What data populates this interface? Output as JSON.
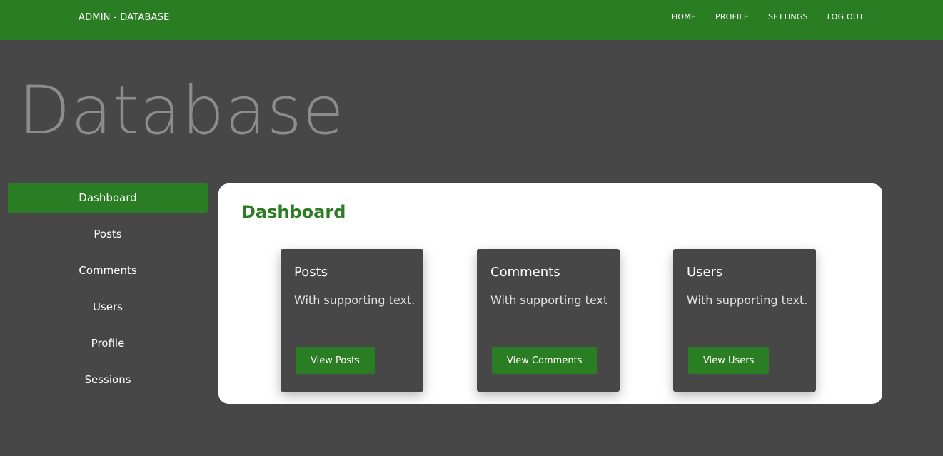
{
  "header": {
    "brand": "ADMIN - DATABASE",
    "nav": [
      "HOME",
      "PROFILE",
      "SETTINGS",
      "LOG OUT"
    ]
  },
  "hero": {
    "title": "Database"
  },
  "sidebar": {
    "items": [
      {
        "label": "Dashboard",
        "active": true
      },
      {
        "label": "Posts"
      },
      {
        "label": "Comments"
      },
      {
        "label": "Users"
      },
      {
        "label": "Profile"
      },
      {
        "label": "Sessions"
      }
    ]
  },
  "main": {
    "title": "Dashboard",
    "cards": [
      {
        "title": "Posts",
        "text": "With supporting text.",
        "button": "View Posts"
      },
      {
        "title": "Comments",
        "text": "With supporting text",
        "button": "View Comments"
      },
      {
        "title": "Users",
        "text": "With supporting text.",
        "button": "View Users"
      }
    ]
  },
  "colors": {
    "brand_green": "#2b7d23",
    "page_background": "#474747",
    "panel_background": "#ffffff"
  }
}
